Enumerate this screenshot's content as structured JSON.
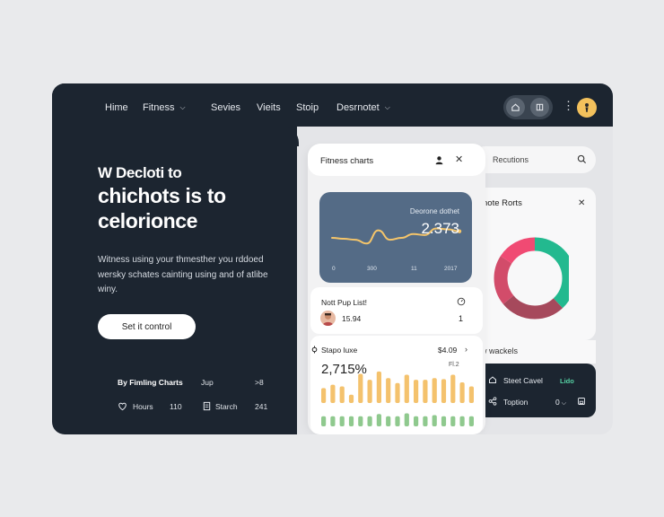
{
  "nav": [
    {
      "label": "Hime",
      "dropdown": false
    },
    {
      "label": "Fitness",
      "dropdown": true
    },
    {
      "label": "Sevies",
      "dropdown": false
    },
    {
      "label": "Vieits",
      "dropdown": false
    },
    {
      "label": "Stoip",
      "dropdown": false
    },
    {
      "label": "Desrnotet",
      "dropdown": true
    }
  ],
  "hero": {
    "title_line1": "W Decloti to",
    "title_line2": "chichots is to",
    "title_line3": "celorionce",
    "description": "Witness using your thmesther you rddoed wersky schates cainting using and of atlibe winy.",
    "cta_label": "Set it control"
  },
  "stats": {
    "heading": "By Fimling Charts",
    "heading_extra": "Jup",
    "heading_value": ">8",
    "hours_label": "Hours",
    "hours_value": "110",
    "starch_label": "Starch",
    "starch_value": "241"
  },
  "fitness_panel": {
    "title": "Fitness charts",
    "line_card": {
      "label": "Deorone dothet",
      "value": "2.373",
      "ticks": [
        "0",
        "300",
        "11",
        "2017"
      ],
      "points": [
        20,
        19,
        18,
        14,
        28,
        18,
        20,
        24,
        23,
        30,
        29,
        27
      ],
      "color": "#f5c56a"
    },
    "list": {
      "title": "Nott Pup List!",
      "value": "15.94",
      "count": "1"
    },
    "bars": {
      "title": "Stapo luxe",
      "price": "$4.09",
      "big_value": "2,715%",
      "small_value": "Fl.2",
      "top_color": "#f4c26d",
      "bottom_color": "#8fc98e",
      "segments": [
        [
          0.45,
          0.45
        ],
        [
          0.45,
          0.55
        ],
        [
          0.45,
          0.5
        ],
        [
          0.45,
          0.25
        ],
        [
          0.45,
          0.88
        ],
        [
          0.45,
          0.7
        ],
        [
          0.55,
          0.95
        ],
        [
          0.45,
          0.75
        ],
        [
          0.45,
          0.6
        ],
        [
          0.58,
          0.85
        ],
        [
          0.45,
          0.7
        ],
        [
          0.45,
          0.7
        ],
        [
          0.5,
          0.75
        ],
        [
          0.45,
          0.72
        ],
        [
          0.45,
          0.85
        ],
        [
          0.45,
          0.62
        ],
        [
          0.45,
          0.5
        ]
      ]
    }
  },
  "side_panel": {
    "search_label": "Recutions",
    "card_title": "note Rorts",
    "donut": [
      {
        "value": 0.38,
        "color": "#23b98f"
      },
      {
        "value": 0.26,
        "color": "#a6495c"
      },
      {
        "value": 0.2,
        "color": "#d24c6a"
      },
      {
        "value": 0.16,
        "color": "#f04a73"
      }
    ],
    "section_title": "w wackels",
    "row1_label": "Steet Cavel",
    "row1_badge": "Lido",
    "row2_label": "Toption",
    "row2_value": "0"
  }
}
